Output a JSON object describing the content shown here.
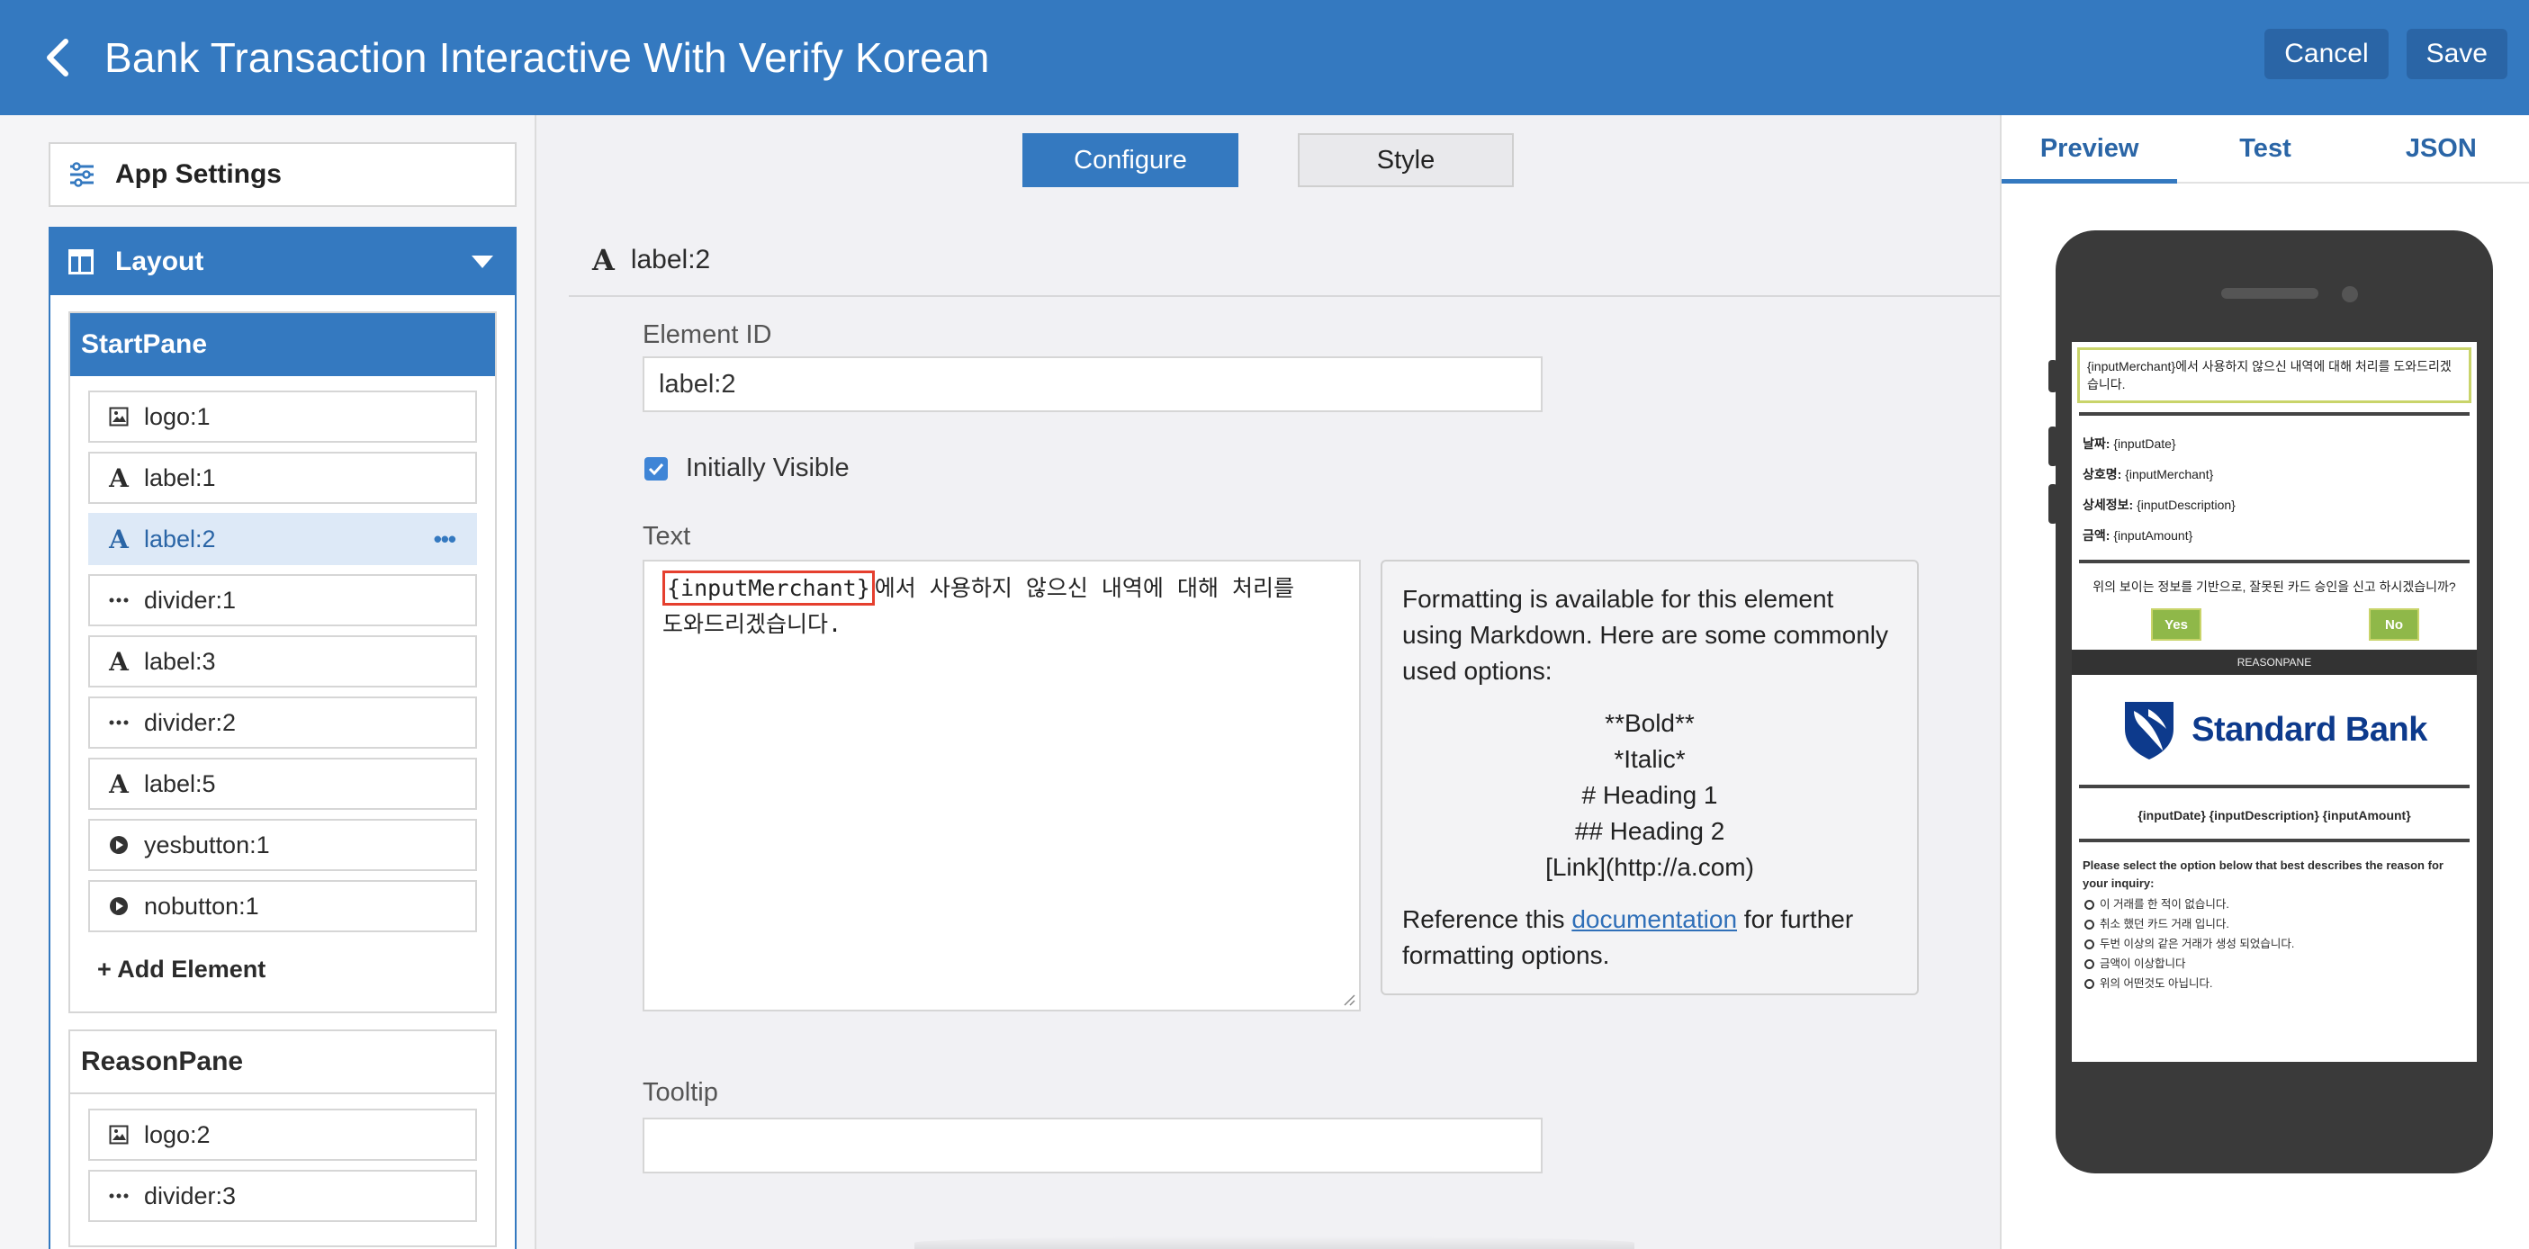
{
  "header": {
    "title": "Bank Transaction Interactive With Verify Korean",
    "cancel_label": "Cancel",
    "save_label": "Save"
  },
  "sidebar": {
    "app_settings_label": "App Settings",
    "layout_label": "Layout",
    "panes": [
      {
        "title": "StartPane",
        "items": [
          {
            "icon": "image-icon",
            "label": "logo:1"
          },
          {
            "icon": "text-icon",
            "label": "label:1"
          },
          {
            "icon": "text-icon",
            "label": "label:2",
            "selected": true
          },
          {
            "icon": "divider-icon",
            "label": "divider:1"
          },
          {
            "icon": "text-icon",
            "label": "label:3"
          },
          {
            "icon": "divider-icon",
            "label": "divider:2"
          },
          {
            "icon": "text-icon",
            "label": "label:5"
          },
          {
            "icon": "play-icon",
            "label": "yesbutton:1"
          },
          {
            "icon": "play-icon",
            "label": "nobutton:1"
          }
        ],
        "add_label": "+ Add Element"
      },
      {
        "title": "ReasonPane",
        "items": [
          {
            "icon": "image-icon",
            "label": "logo:2"
          },
          {
            "icon": "divider-icon",
            "label": "divider:3"
          }
        ]
      }
    ]
  },
  "main": {
    "tabs": [
      "Configure",
      "Style"
    ],
    "element_title": "label:2",
    "element_id_label": "Element ID",
    "element_id_value": "label:2",
    "visible_label": "Initially Visible",
    "text_label": "Text",
    "text_var": "{inputMerchant}",
    "text_line1_rest": "에서 사용하지 않으신 내역에 대해 처리를",
    "text_line2": "도와드리겠습니다.",
    "help": {
      "intro": "Formatting is available for this element using Markdown. Here are some commonly used options:",
      "lines": [
        "**Bold**",
        "*Italic*",
        "# Heading 1",
        "## Heading 2",
        "[Link](http://a.com)"
      ],
      "ref_prefix": "Reference this ",
      "ref_link": "documentation",
      "ref_suffix": " for further formatting options."
    },
    "tooltip_label": "Tooltip",
    "tooltip_value": ""
  },
  "preview": {
    "tabs": [
      "Preview",
      "Test",
      "JSON"
    ],
    "message": "{inputMerchant}에서 사용하지 않으신 내역에 대해 처리를 도와드리겠습니다.",
    "fields": [
      {
        "key": "날짜:",
        "value": "{inputDate}"
      },
      {
        "key": "상호명:",
        "value": "{inputMerchant}"
      },
      {
        "key": "상세정보:",
        "value": "{inputDescription}"
      },
      {
        "key": "금액:",
        "value": "{inputAmount}"
      }
    ],
    "question": "위의 보이는 정보를 기반으로, 잘못된 카드 승인을 신고 하시겠습니까?",
    "yes_label": "Yes",
    "no_label": "No",
    "pane_label": "REASONPANE",
    "logo_text": "Standard Bank",
    "vars_line": "{inputDate} {inputDescription} {inputAmount}",
    "reason_prompt": "Please select the option below that best describes the reason for your inquiry:",
    "options": [
      "이 거래를 한 적이 없습니다.",
      "취소 했던 카드 거래 입니다.",
      "두번 이상의 같은 거래가 생성 되었습니다.",
      "금액이 이상합니다",
      "위의 어떤것도 아닙니다."
    ],
    "colors": {
      "accent": "#3479c0",
      "button_green": "#8fb849",
      "highlight": "#e53f2e"
    }
  }
}
